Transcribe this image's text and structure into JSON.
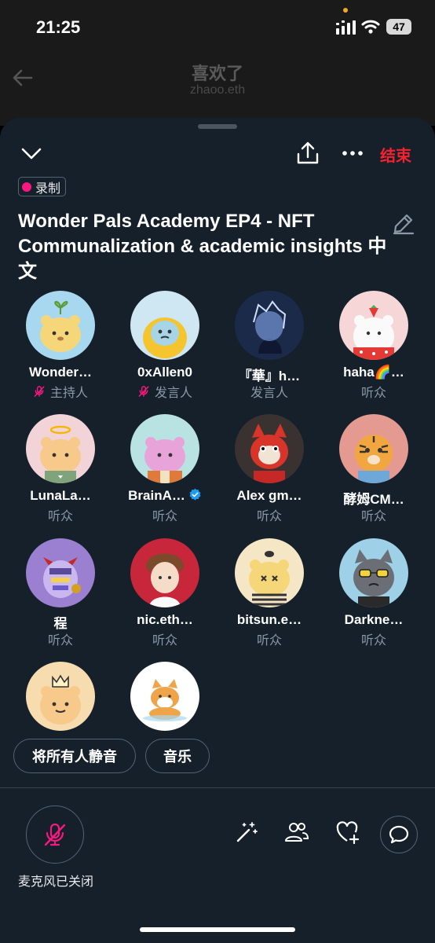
{
  "status_bar": {
    "time": "21:25",
    "battery": "47",
    "signal_icon": "cellular-signal-icon",
    "wifi_icon": "wifi-icon"
  },
  "background_page": {
    "title": "喜欢了",
    "subtitle": "zhaoo.eth",
    "back_icon": "arrow-left-icon"
  },
  "space": {
    "header": {
      "collapse_icon": "chevron-down-icon",
      "share_icon": "share-icon",
      "more_icon": "more-horizontal-icon",
      "end_label": "结束"
    },
    "recording_label": "录制",
    "title": "Wonder Pals Academy EP4 - NFT Communalization & academic insights 中文",
    "edit_icon": "pencil-icon",
    "participants": [
      {
        "name": "Wonder…",
        "role": "主持人",
        "muted": true,
        "avatar": "bear-sprout-avatar",
        "bg": "#a8d8f0"
      },
      {
        "name": "0xAllen0",
        "role": "发言人",
        "muted": true,
        "avatar": "yellow-raincoat-avatar",
        "bg": "#cfe7f2"
      },
      {
        "name": "『華』h…",
        "role": "发言人",
        "muted": false,
        "avatar": "anime-blue-avatar",
        "bg": "#1c2a4a"
      },
      {
        "name": "haha🌈…",
        "role": "听众",
        "muted": false,
        "avatar": "white-bear-strawberry-avatar",
        "bg": "#f6d6d6"
      },
      {
        "name": "LunaLa…",
        "role": "听众",
        "muted": false,
        "avatar": "bear-halo-avatar",
        "bg": "#f2d3d8"
      },
      {
        "name": "BrainA…",
        "role": "听众",
        "muted": false,
        "verified": true,
        "avatar": "pink-bear-avatar",
        "bg": "#b9e3e3"
      },
      {
        "name": "Alex ɡm…",
        "role": "听众",
        "muted": false,
        "avatar": "red-cat-avatar",
        "bg": "#3a3230"
      },
      {
        "name": "酵姆CM…",
        "role": "听众",
        "muted": false,
        "avatar": "tiger-avatar",
        "bg": "#e49a90"
      },
      {
        "name": "程",
        "role": "听众",
        "muted": false,
        "avatar": "purple-devil-avatar",
        "bg": "#9b7fd0"
      },
      {
        "name": "nic.eth…",
        "role": "听众",
        "muted": false,
        "avatar": "anime-boy-avatar",
        "bg": "#c8263a"
      },
      {
        "name": "bitsun.e…",
        "role": "听众",
        "muted": false,
        "avatar": "bear-bee-avatar",
        "bg": "#f5e6c6"
      },
      {
        "name": "Darkne…",
        "role": "听众",
        "muted": false,
        "avatar": "gray-cat-sunglasses-avatar",
        "bg": "#9ed0e8"
      },
      {
        "name": "",
        "role": "",
        "muted": false,
        "avatar": "bear-crown-avatar",
        "bg": "#f6dcae"
      },
      {
        "name": "",
        "role": "",
        "muted": false,
        "avatar": "shiba-dog-avatar",
        "bg": "#ffffff"
      }
    ],
    "actions": {
      "mute_all": "将所有人静音",
      "music": "音乐"
    },
    "bottom": {
      "mic_status": "麦克风已关闭",
      "mic_icon": "mic-off-icon",
      "effects_icon": "magic-wand-icon",
      "people_icon": "people-icon",
      "react_icon": "heart-plus-icon",
      "chat_icon": "chat-bubble-icon"
    }
  },
  "colors": {
    "sheet_bg": "#15202b",
    "accent_red": "#f4212e",
    "accent_pink": "#f91880",
    "muted_text": "#8b98a5",
    "verified_blue": "#1d9bf0"
  }
}
